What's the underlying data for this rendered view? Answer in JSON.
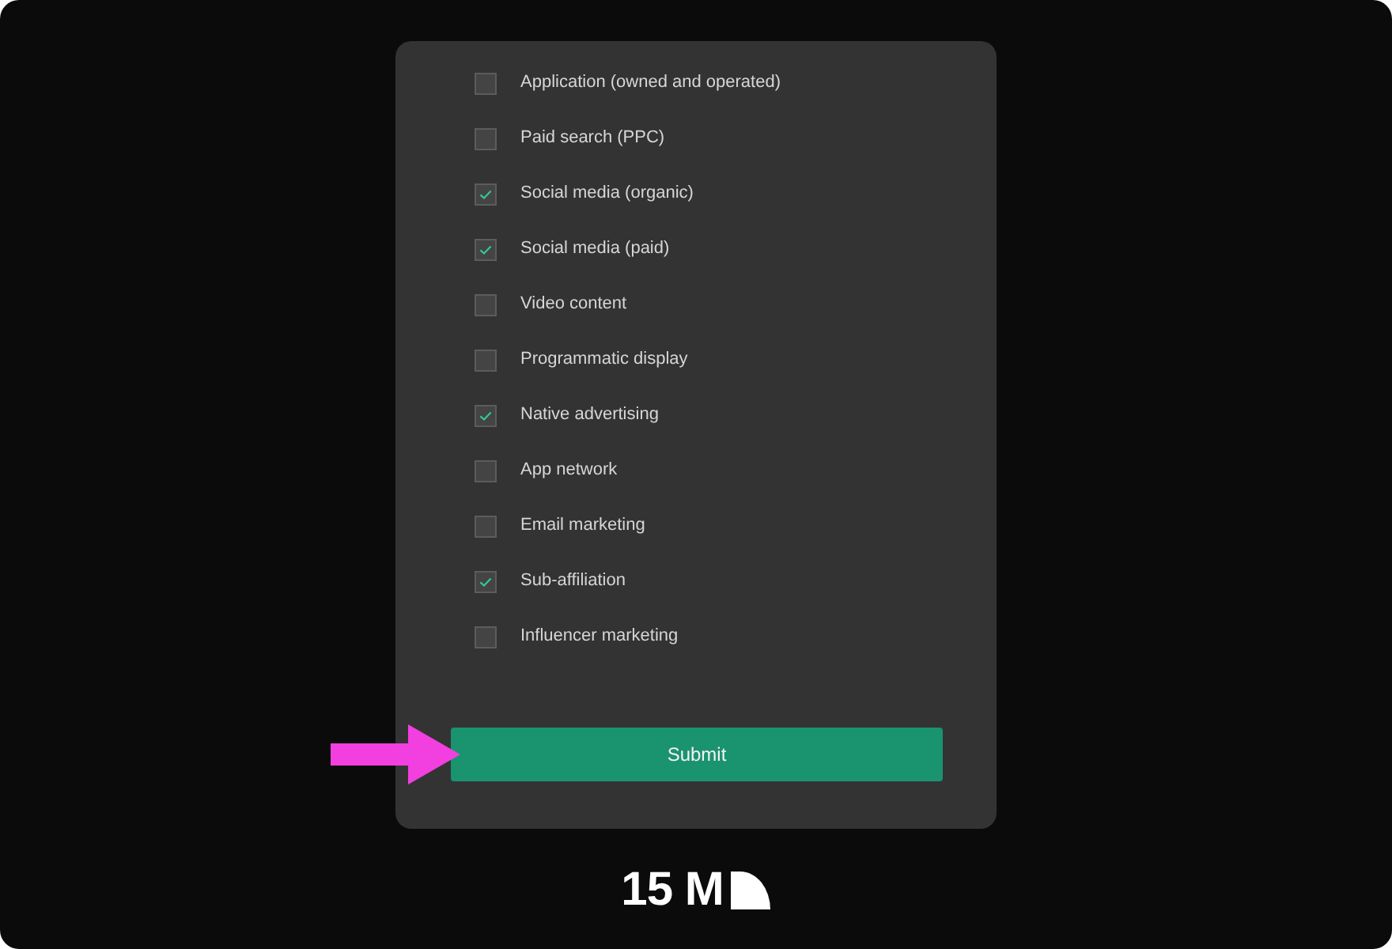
{
  "options": [
    {
      "label": "Application (owned and operated)",
      "checked": false
    },
    {
      "label": "Paid search (PPC)",
      "checked": false
    },
    {
      "label": "Social media (organic)",
      "checked": true
    },
    {
      "label": "Social media (paid)",
      "checked": true
    },
    {
      "label": "Video content",
      "checked": false
    },
    {
      "label": "Programmatic display",
      "checked": false
    },
    {
      "label": "Native advertising",
      "checked": true
    },
    {
      "label": "App network",
      "checked": false
    },
    {
      "label": "Email marketing",
      "checked": false
    },
    {
      "label": "Sub-affiliation",
      "checked": true
    },
    {
      "label": "Influencer marketing",
      "checked": false
    }
  ],
  "submit": {
    "label": "Submit"
  },
  "logo": {
    "text": "15 M"
  }
}
